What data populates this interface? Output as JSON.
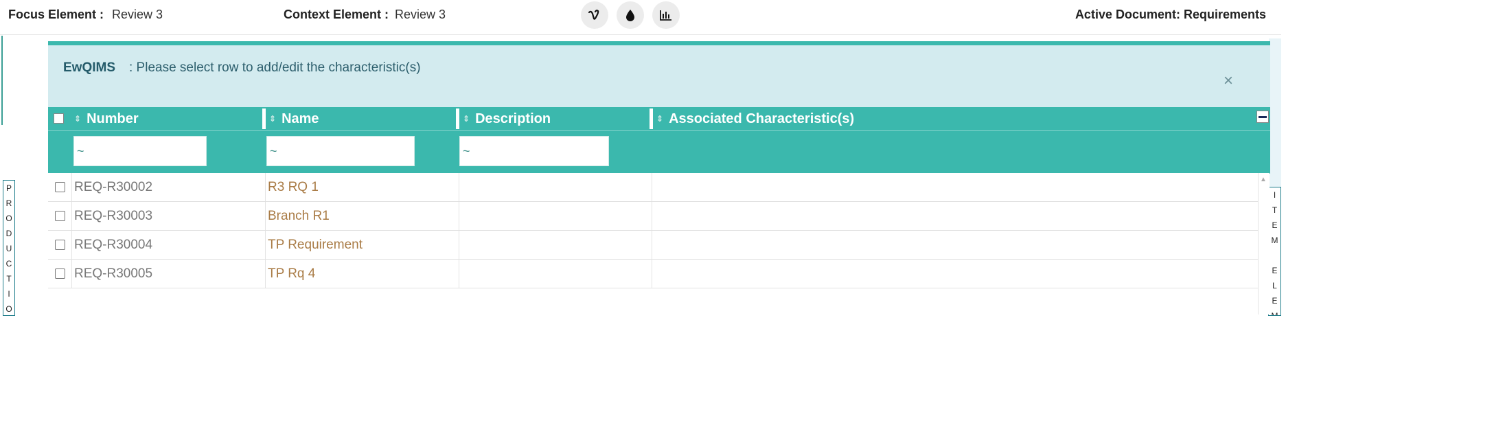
{
  "header": {
    "focus_label": "Focus Element :",
    "focus_value": "Review 3",
    "context_label": "Context Element :",
    "context_value": "Review 3",
    "active_document": "Active Document: Requirements",
    "icons": [
      "vimeo-icon",
      "droplet-icon",
      "bar-chart-icon"
    ]
  },
  "side_tabs": {
    "left": [
      "P",
      "R",
      "O",
      "D",
      "U",
      "C",
      "T",
      "I",
      "O"
    ],
    "right": [
      "I",
      "T",
      "E",
      "M",
      "",
      "E",
      "L",
      "E",
      "M"
    ]
  },
  "alert": {
    "brand": "EwQIMS",
    "message": ": Please select row to add/edit the characteristic(s)",
    "close": "×"
  },
  "grid": {
    "columns": [
      "Number",
      "Name",
      "Description",
      "Associated Characteristic(s)"
    ],
    "sort_glyph": "⇕",
    "filter_values": [
      "~",
      "~",
      "~"
    ],
    "rows": [
      {
        "number": "REQ-R30002",
        "name": "R3 RQ 1",
        "description": "",
        "associated": ""
      },
      {
        "number": "REQ-R30003",
        "name": "Branch R1",
        "description": "",
        "associated": ""
      },
      {
        "number": "REQ-R30004",
        "name": "TP Requirement",
        "description": "",
        "associated": ""
      },
      {
        "number": "REQ-R30005",
        "name": "TP Rq 4",
        "description": "",
        "associated": ""
      }
    ],
    "scroll_up_glyph": "▲"
  },
  "colors": {
    "accent": "#3bb8ad",
    "alert_bg": "#d3ebef",
    "link": "#a97b45"
  }
}
